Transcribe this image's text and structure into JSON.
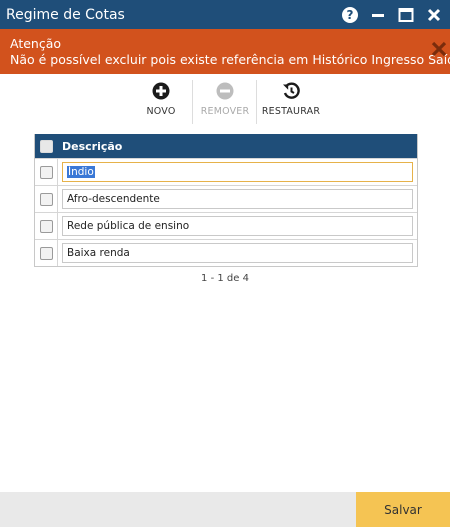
{
  "window": {
    "title": "Regime de Cotas"
  },
  "alert": {
    "title": "Atenção",
    "message": "Não é possível excluir pois existe referência em Histórico Ingresso Saída."
  },
  "toolbar": {
    "new_label": "NOVO",
    "remove_label": "REMOVER",
    "restore_label": "RESTAURAR"
  },
  "table": {
    "header": "Descrição",
    "rows": [
      {
        "value": "Índio"
      },
      {
        "value": "Afro-descendente"
      },
      {
        "value": "Rede pública de ensino"
      },
      {
        "value": "Baixa renda"
      }
    ]
  },
  "pager": {
    "text": "1 - 1 de 4"
  },
  "footer": {
    "save_label": "Salvar"
  },
  "colors": {
    "titlebar": "#1f4e79",
    "alert": "#d2521d",
    "table_header": "#1f4e79",
    "save_button": "#f5c453"
  }
}
